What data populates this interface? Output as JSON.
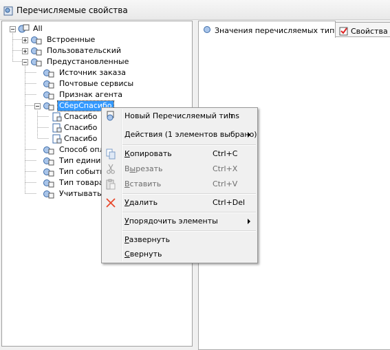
{
  "window": {
    "title": "Перечисляемые свойства"
  },
  "tree": {
    "nodes": [
      {
        "label": "All"
      },
      {
        "label": "Встроенные"
      },
      {
        "label": "Пользовательский"
      },
      {
        "label": "Предустановленные"
      },
      {
        "label": "Источник заказа"
      },
      {
        "label": "Почтовые сервисы"
      },
      {
        "label": "Признак агента"
      },
      {
        "label": "СберСпасибо"
      },
      {
        "label": "Спасибо"
      },
      {
        "label": "Спасибо"
      },
      {
        "label": "Спасибо"
      },
      {
        "label": "Способ опла"
      },
      {
        "label": "Тип единицы"
      },
      {
        "label": "Тип события"
      },
      {
        "label": "Тип товара"
      },
      {
        "label": "Учитывать в"
      }
    ]
  },
  "tabs": [
    {
      "label": "Значения перечисляемых типов"
    },
    {
      "label": "Свойства"
    }
  ],
  "context_menu": {
    "new_item": {
      "label": "Новый Перечисляемый тип",
      "shortcut": "Ins"
    },
    "actions": {
      "label": "Действия (1 элементов выбрано)"
    },
    "copy": {
      "label_u": "К",
      "label_rest": "опировать",
      "shortcut": "Ctrl+C"
    },
    "cut": {
      "label_pre": "В",
      "label_u": "ы",
      "label_rest": "резать",
      "shortcut": "Ctrl+X"
    },
    "paste": {
      "label_u": "В",
      "label_rest": "ставить",
      "shortcut": "Ctrl+V"
    },
    "delete": {
      "label_u": "У",
      "label_rest": "далить",
      "shortcut": "Ctrl+Del"
    },
    "sort": {
      "label_u": "У",
      "label_rest": "порядочить элементы"
    },
    "expand": {
      "label_u": "Р",
      "label_rest": "азвернуть"
    },
    "collapse": {
      "label_u": "С",
      "label_rest": "вернуть"
    }
  },
  "colors": {
    "selection": "#3399ff",
    "delete_icon": "#e8472a"
  }
}
